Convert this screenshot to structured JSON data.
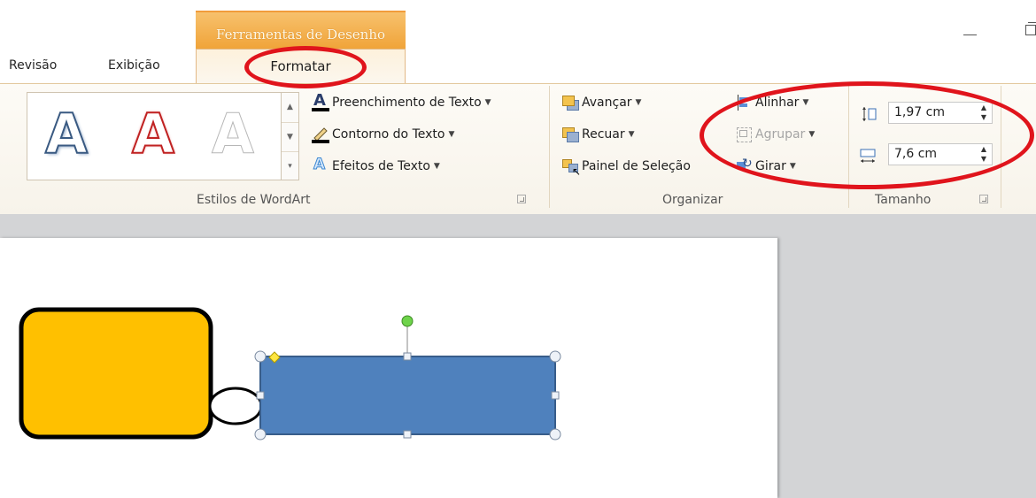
{
  "tabs": {
    "revisao": "Revisão",
    "exibicao": "Exibição",
    "contextual_title": "Ferramentas de Desenho",
    "formatar": "Formatar"
  },
  "wordart": {
    "letter": "A",
    "text_fill": "Preenchimento de Texto",
    "text_outline": "Contorno do Texto",
    "text_effects": "Efeitos de Texto",
    "group_label": "Estilos de WordArt"
  },
  "organizar": {
    "avancar": "Avançar",
    "recuar": "Recuar",
    "painel_selecao": "Painel de Seleção",
    "alinhar": "Alinhar",
    "agrupar": "Agrupar",
    "girar": "Girar",
    "group_label": "Organizar"
  },
  "tamanho": {
    "height_value": "1,97 cm",
    "width_value": "7,6 cm",
    "group_label": "Tamanho"
  },
  "colors": {
    "accent_orange": "#f0a338",
    "annotation_red": "#e0141c",
    "shape_yellow": "#ffc000",
    "shape_blue": "#4f81bd"
  }
}
